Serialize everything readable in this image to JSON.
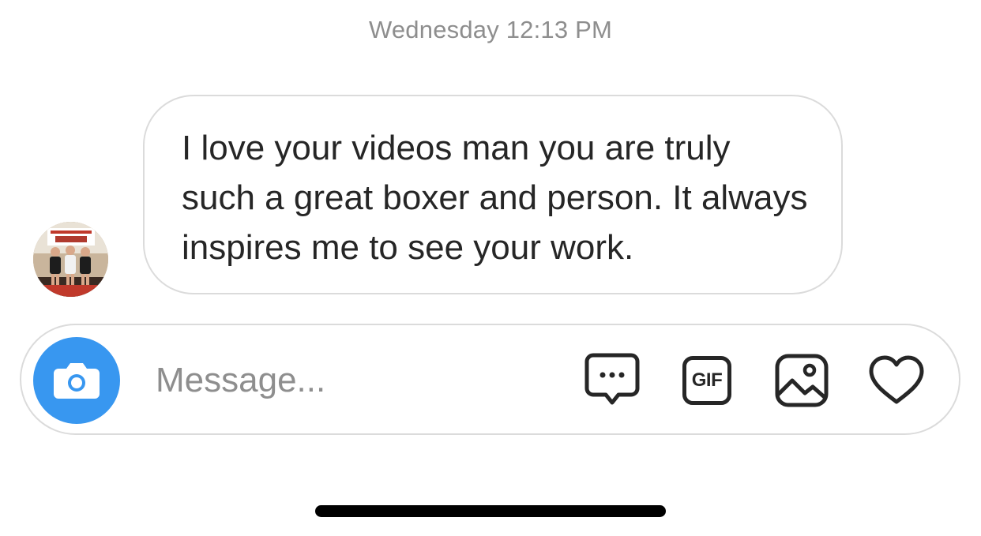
{
  "thread": {
    "timestamp": "Wednesday 12:13 PM",
    "message": {
      "text": "I love your videos man you are truly such a great boxer and person. It always inspires me to see your work."
    }
  },
  "composer": {
    "placeholder": "Message...",
    "camera_icon": "camera-icon",
    "more_icon": "chat-bubble-dots-icon",
    "gif_label": "GIF",
    "gallery_icon": "image-icon",
    "like_icon": "heart-icon"
  },
  "colors": {
    "accent": "#3897f0",
    "border": "#dbdbdb",
    "text": "#262626",
    "muted": "#8e8e8e"
  }
}
